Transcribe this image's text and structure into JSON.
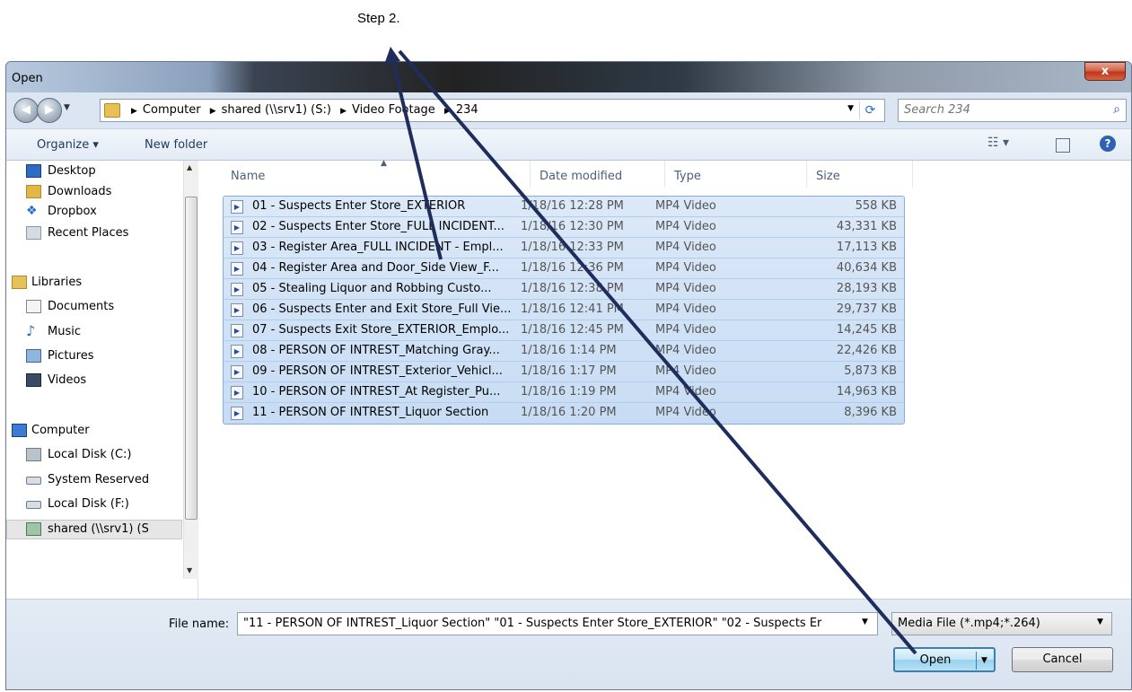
{
  "annotation": {
    "label": "Step 2."
  },
  "window": {
    "title": "Open",
    "close_glyph": "x"
  },
  "address": {
    "crumbs": [
      "Computer",
      "shared (\\\\srv1) (S:)",
      "Video Footage",
      "234"
    ],
    "search_placeholder": "Search 234"
  },
  "toolbar": {
    "organize": "Organize ▾",
    "new_folder": "New folder"
  },
  "nav": {
    "items": [
      {
        "label": "Desktop",
        "icon": "desktop-icon"
      },
      {
        "label": "Downloads",
        "icon": "downloads-icon"
      },
      {
        "label": "Dropbox",
        "icon": "dropbox-icon"
      },
      {
        "label": "Recent Places",
        "icon": "recent-places-icon"
      },
      {
        "label": "Libraries",
        "icon": "libraries-icon"
      },
      {
        "label": "Documents",
        "icon": "documents-icon"
      },
      {
        "label": "Music",
        "icon": "music-icon"
      },
      {
        "label": "Pictures",
        "icon": "pictures-icon"
      },
      {
        "label": "Videos",
        "icon": "videos-icon"
      },
      {
        "label": "Computer",
        "icon": "computer-icon"
      },
      {
        "label": "Local Disk (C:)",
        "icon": "drive-icon"
      },
      {
        "label": "System Reserved",
        "icon": "drive-icon"
      },
      {
        "label": "Local Disk (F:)",
        "icon": "drive-icon"
      },
      {
        "label": "shared (\\\\srv1) (S",
        "icon": "network-drive-icon"
      }
    ]
  },
  "columns": {
    "name": "Name",
    "date": "Date modified",
    "type": "Type",
    "size": "Size"
  },
  "files": [
    {
      "name": "01 - Suspects Enter Store_EXTERIOR",
      "date": "1/18/16 12:28 PM",
      "type": "MP4 Video",
      "size": "558 KB"
    },
    {
      "name": "02 - Suspects Enter Store_FULL INCIDENT...",
      "date": "1/18/16 12:30 PM",
      "type": "MP4 Video",
      "size": "43,331 KB"
    },
    {
      "name": "03 - Register Area_FULL INCIDENT - Empl...",
      "date": "1/18/16 12:33 PM",
      "type": "MP4 Video",
      "size": "17,113 KB"
    },
    {
      "name": "04 - Register Area and Door_Side View_F...",
      "date": "1/18/16 12:36 PM",
      "type": "MP4 Video",
      "size": "40,634 KB"
    },
    {
      "name": "05 - Stealing Liquor and Robbing Custo...",
      "date": "1/18/16 12:38 PM",
      "type": "MP4 Video",
      "size": "28,193 KB"
    },
    {
      "name": "06 - Suspects Enter and Exit Store_Full Vie...",
      "date": "1/18/16 12:41 PM",
      "type": "MP4 Video",
      "size": "29,737 KB"
    },
    {
      "name": "07 - Suspects Exit Store_EXTERIOR_Emplo...",
      "date": "1/18/16 12:45 PM",
      "type": "MP4 Video",
      "size": "14,245 KB"
    },
    {
      "name": "08 - PERSON OF INTREST_Matching Gray...",
      "date": "1/18/16 1:14 PM",
      "type": "MP4 Video",
      "size": "22,426 KB"
    },
    {
      "name": "09 - PERSON OF INTREST_Exterior_Vehicl...",
      "date": "1/18/16 1:17 PM",
      "type": "MP4 Video",
      "size": "5,873 KB"
    },
    {
      "name": "10 - PERSON OF INTREST_At Register_Pu...",
      "date": "1/18/16 1:19 PM",
      "type": "MP4 Video",
      "size": "14,963 KB"
    },
    {
      "name": "11 - PERSON OF INTREST_Liquor Section",
      "date": "1/18/16 1:20 PM",
      "type": "MP4 Video",
      "size": "8,396 KB"
    }
  ],
  "footer": {
    "file_name_label": "File name:",
    "file_name_value": "\"11 - PERSON OF INTREST_Liquor Section\" \"01 - Suspects Enter Store_EXTERIOR\" \"02 - Suspects Er",
    "file_type": "Media File (*.mp4;*.264)",
    "open_label": "Open",
    "cancel_label": "Cancel"
  },
  "colors": {
    "arrow": "#1f2d5c",
    "selection": "#cde0f5",
    "accent": "#3c7fb1"
  }
}
